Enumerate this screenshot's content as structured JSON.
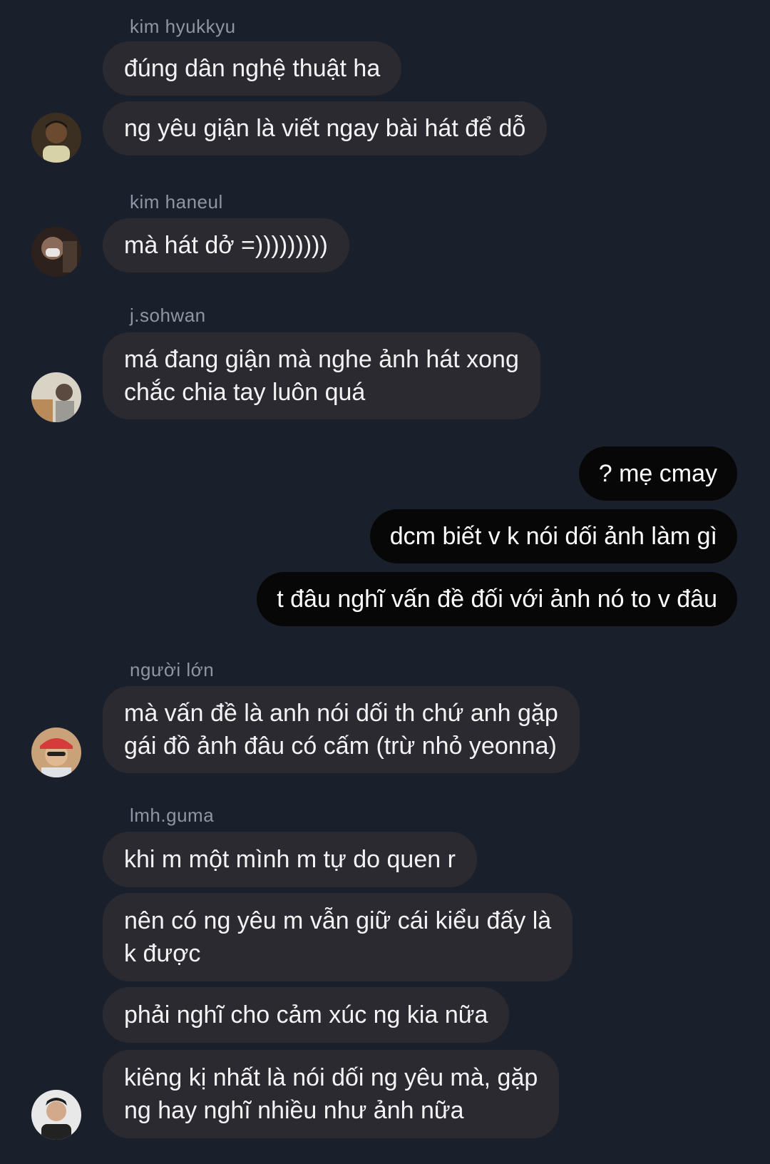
{
  "groups": [
    {
      "sender": "kim hyukkyu",
      "messages": [
        "đúng dân nghệ thuật ha",
        "ng yêu giận là viết ngay bài hát để dỗ"
      ],
      "avatar_icon": "user-avatar-icon"
    },
    {
      "sender": "kim haneul",
      "messages": [
        "mà hát dở =)))))))))"
      ],
      "avatar_icon": "user-avatar-icon"
    },
    {
      "sender": "j.sohwan",
      "messages": [
        "má đang giận mà nghe ảnh hát xong\nchắc chia tay luôn quá"
      ],
      "avatar_icon": "user-avatar-icon"
    },
    {
      "sender": "người lớn",
      "messages": [
        "mà vấn đề là anh nói dối th chứ anh gặp\ngái đồ ảnh đâu có cấm (trừ nhỏ yeonna)"
      ],
      "avatar_icon": "user-avatar-icon"
    },
    {
      "sender": "lmh.guma",
      "messages": [
        "khi m một mình m tự do quen r",
        "nên có ng yêu m vẫn giữ cái kiểu đấy là\nk được",
        "phải nghĩ cho cảm xúc ng kia nữa",
        "kiêng kị nhất là nói dối ng yêu mà, gặp\nng hay nghĩ nhiều như ảnh nữa"
      ],
      "avatar_icon": "user-avatar-icon"
    }
  ],
  "outgoing": [
    "? mẹ cmay",
    "dcm biết v k nói dối ảnh làm gì",
    "t đâu nghĩ vấn đề đối với ảnh nó to v đâu"
  ],
  "colors": {
    "background": "#1a202b",
    "incoming_bubble": "#2b2a31",
    "outgoing_bubble": "#070707",
    "sender_name": "#8f96a3"
  }
}
